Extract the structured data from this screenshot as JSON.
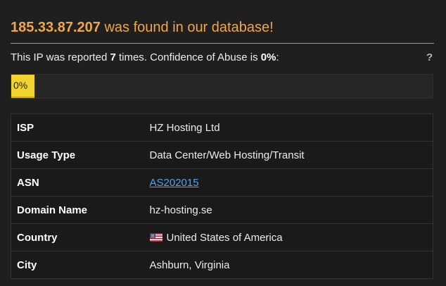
{
  "header": {
    "ip": "185.33.87.207",
    "found_text": " was found in our database!"
  },
  "report": {
    "prefix": "This IP was reported ",
    "count": "7",
    "middle": " times. Confidence of Abuse is ",
    "confidence": "0%",
    "suffix": ":",
    "help": "?"
  },
  "abuse_bar": {
    "label": "0%",
    "value": 0,
    "color": "#f2d42f"
  },
  "details": [
    {
      "key": "ISP",
      "value": "HZ Hosting Ltd"
    },
    {
      "key": "Usage Type",
      "value": "Data Center/Web Hosting/Transit"
    },
    {
      "key": "ASN",
      "value": "AS202015",
      "link": true
    },
    {
      "key": "Domain Name",
      "value": "hz-hosting.se"
    },
    {
      "key": "Country",
      "value": "United States of America",
      "icon": "us-flag-icon"
    },
    {
      "key": "City",
      "value": "Ashburn, Virginia"
    }
  ],
  "colors": {
    "accent": "#f0a64a",
    "link": "#5aa0e6",
    "background": "#1f1f1f"
  }
}
